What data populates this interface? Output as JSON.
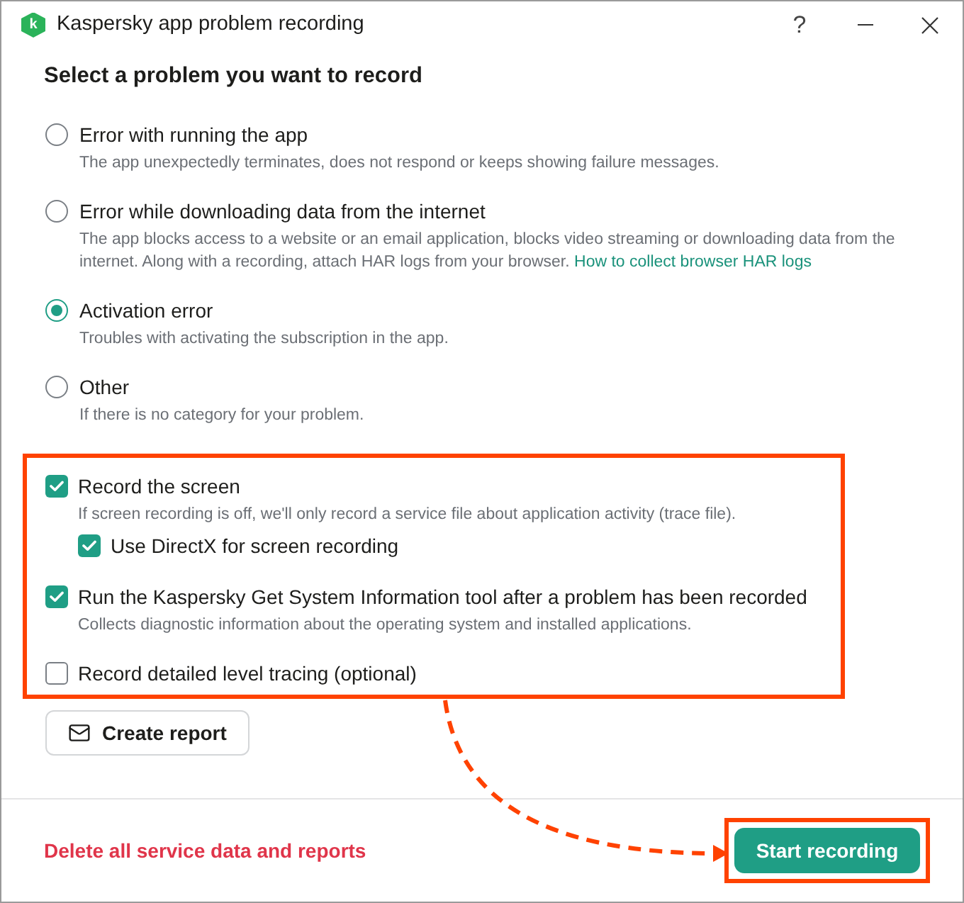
{
  "window": {
    "logo": "k",
    "title": "Kaspersky app problem recording",
    "help": "?"
  },
  "heading": "Select a problem you want to record",
  "problems": [
    {
      "label": "Error with running the app",
      "description": "The app unexpectedly terminates, does not respond or keeps showing failure messages.",
      "selected": false
    },
    {
      "label": "Error while downloading data from the internet",
      "description": "The app blocks access to a website or an email application, blocks video streaming or downloading data from the internet. Along with a recording, attach HAR logs from your browser.",
      "link": "How to collect browser HAR logs",
      "selected": false
    },
    {
      "label": "Activation error",
      "description": "Troubles with activating the subscription in the app.",
      "selected": true
    },
    {
      "label": "Other",
      "description": "If there is no category for your problem.",
      "selected": false
    }
  ],
  "options": [
    {
      "label": "Record the screen",
      "description": "If screen recording is off, we'll only record a service file about application activity (trace file).",
      "checked": true,
      "children": [
        {
          "label": "Use DirectX for screen recording",
          "checked": true
        }
      ]
    },
    {
      "label": "Run the Kaspersky Get System Information tool after a problem has been recorded",
      "description": "Collects diagnostic information about the operating system and installed applications.",
      "checked": true
    },
    {
      "label": "Record detailed level tracing (optional)",
      "checked": false
    }
  ],
  "create_report": "Create report",
  "footer": {
    "delete_link": "Delete all service data and reports",
    "start_button": "Start recording"
  }
}
